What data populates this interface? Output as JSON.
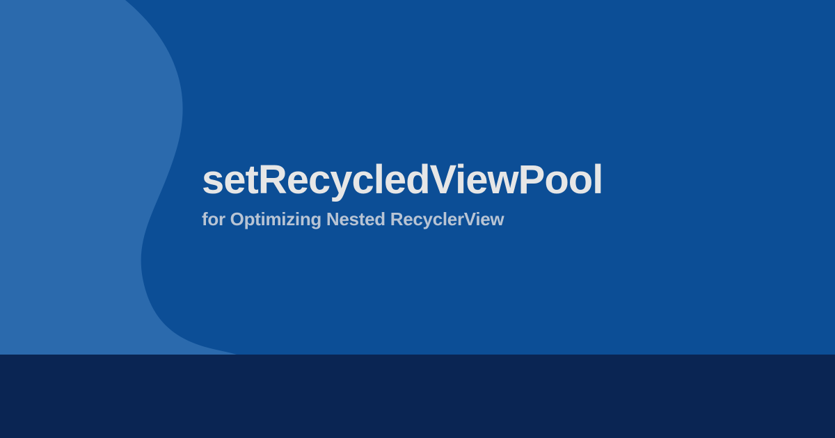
{
  "title": "setRecycledViewPool",
  "subtitle": "for Optimizing Nested RecyclerView",
  "colors": {
    "background": "#0c4e96",
    "wave_outer": "#4a7ab4",
    "wave_inner": "#2b6aad",
    "footer": "#0a2553",
    "title_text": "#e6e6e6",
    "subtitle_text": "#b8c4d4"
  }
}
